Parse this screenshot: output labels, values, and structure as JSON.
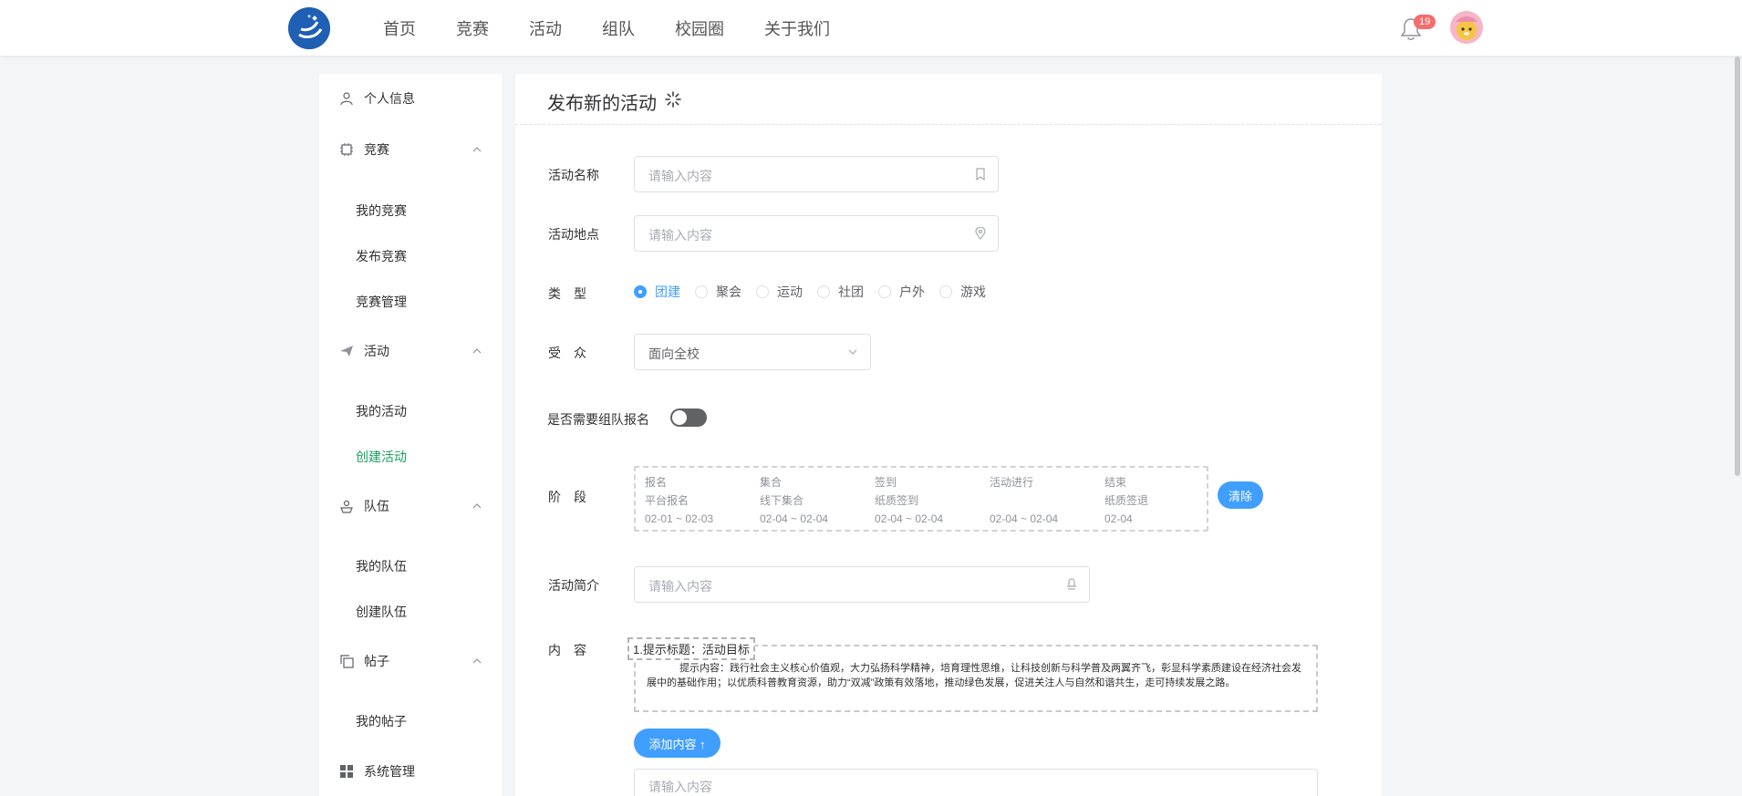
{
  "nav": {
    "items": [
      "首页",
      "竞赛",
      "活动",
      "组队",
      "校园圈",
      "关于我们"
    ],
    "badge": "19"
  },
  "sidebar": {
    "profile": "个人信息",
    "competition": {
      "label": "竞赛",
      "items": [
        "我的竞赛",
        "发布竞赛",
        "竞赛管理"
      ]
    },
    "activity": {
      "label": "活动",
      "items": [
        "我的活动",
        "创建活动"
      ]
    },
    "team": {
      "label": "队伍",
      "items": [
        "我的队伍",
        "创建队伍"
      ]
    },
    "post": {
      "label": "帖子",
      "items": [
        "我的帖子"
      ]
    },
    "system": "系统管理"
  },
  "form": {
    "title": "发布新的活动",
    "name_label": "活动名称",
    "name_placeholder": "请输入内容",
    "place_label": "活动地点",
    "place_placeholder": "请输入内容",
    "type_label": "类　型",
    "types": [
      "团建",
      "聚会",
      "运动",
      "社团",
      "户外",
      "游戏"
    ],
    "selected_type": "团建",
    "audience_label": "受　众",
    "audience_value": "面向全校",
    "team_label": "是否需要组队报名",
    "team_enabled": false,
    "stage_label": "阶　段",
    "stages": [
      {
        "name": "报名",
        "mode": "平台报名",
        "range": "02-01 ~ 02-03"
      },
      {
        "name": "集合",
        "mode": "线下集合",
        "range": "02-04 ~ 02-04"
      },
      {
        "name": "签到",
        "mode": "纸质签到",
        "range": "02-04 ~ 02-04"
      },
      {
        "name": "活动进行",
        "mode": "",
        "range": "02-04 ~ 02-04"
      },
      {
        "name": "结束",
        "mode": "纸质签退",
        "range": "02-04"
      }
    ],
    "clear_button": "清除",
    "intro_label": "活动简介",
    "intro_placeholder": "请输入内容",
    "content_label": "内　容",
    "content_tag": "1.提示标题：活动目标",
    "content_text": "提示内容：践行社会主义核心价值观，大力弘扬科学精神，培育理性思维，让科技创新与科学普及两翼齐飞，彰显科学素质建设在经济社会发展中的基础作用；以优质科普教育资源，助力“双减”政策有效落地，推动绿色发展，促进关注人与自然和谐共生，走可持续发展之路。",
    "add_content_button": "添加内容 ↑",
    "bottom_placeholder": "请输入内容"
  }
}
